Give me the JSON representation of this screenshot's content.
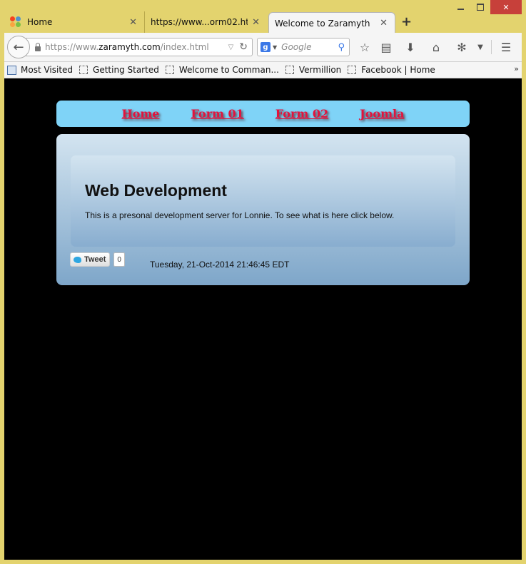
{
  "browser": {
    "tabs": [
      {
        "label": "Home",
        "icon": "joomla-icon"
      },
      {
        "label": "https://www...orm02.html"
      },
      {
        "label": "Welcome to Zaramyth",
        "active": true
      }
    ],
    "new_tab": "+",
    "url": {
      "prefix": "https://www.",
      "domain": "zaramyth.com",
      "path": "/index.html"
    },
    "search_placeholder": "Google",
    "bookmarks": [
      "Most Visited",
      "Getting Started",
      "Welcome to Comman...",
      "Vermillion",
      "Facebook | Home"
    ],
    "bookmarks_more": "»"
  },
  "page": {
    "nav": [
      "Home",
      "Form 01",
      "Form 02",
      "Joomla"
    ],
    "heading": "Web Development",
    "intro": "This is a presonal development server for Lonnie. To see what is here click below.",
    "tweet_label": "Tweet",
    "tweet_count": "0",
    "timestamp": "Tuesday, 21-Oct-2014 21:46:45 EDT"
  },
  "colors": {
    "window_frame": "#e3d36e",
    "nav_bar_bg": "#7fd3f7",
    "nav_link": "#e2133d",
    "page_bg": "#000000",
    "close_button": "#c7403a"
  }
}
